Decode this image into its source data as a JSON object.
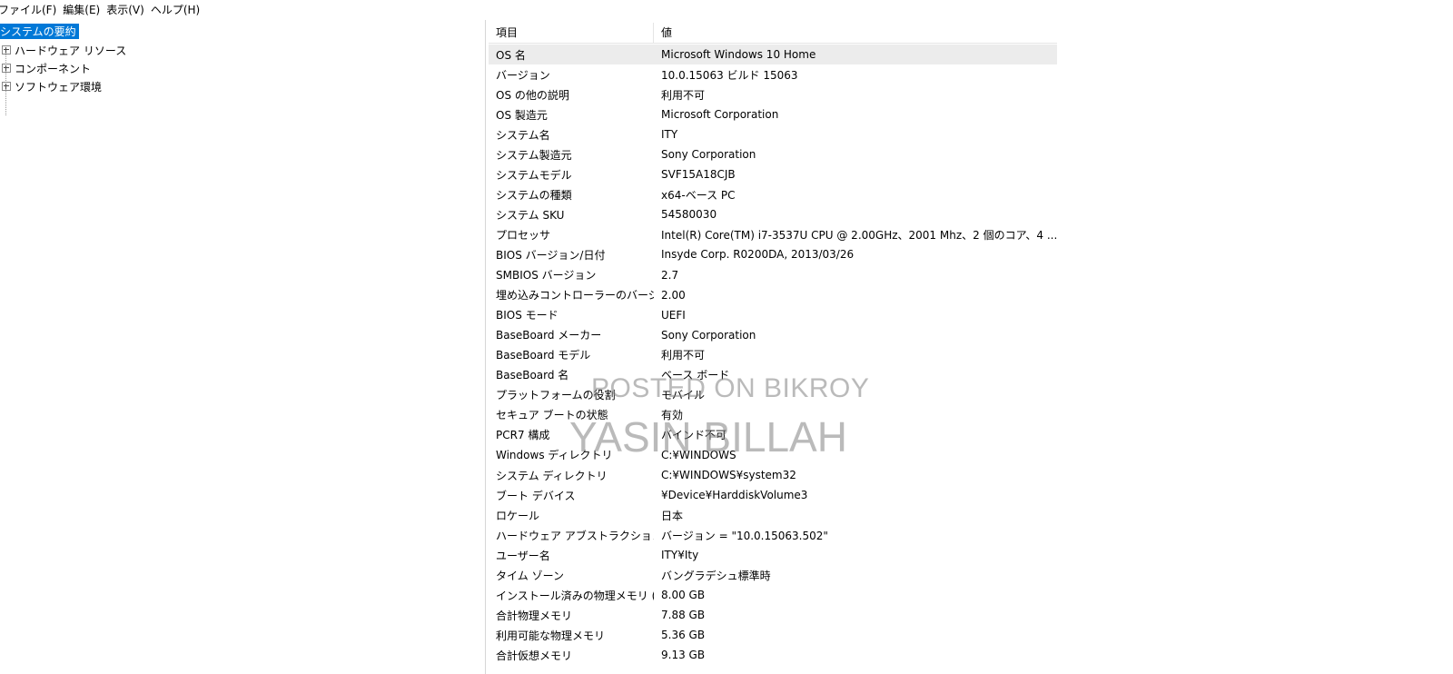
{
  "menubar": {
    "items": [
      "ファイル(F)",
      "編集(E)",
      "表示(V)",
      "ヘルプ(H)"
    ]
  },
  "tree": {
    "root": "システムの要約",
    "children": [
      "ハードウェア リソース",
      "コンポーネント",
      "ソフトウェア環境"
    ]
  },
  "table": {
    "headers": {
      "item": "項目",
      "value": "値"
    },
    "rows": [
      {
        "item": "OS 名",
        "value": "Microsoft Windows 10 Home"
      },
      {
        "item": "バージョン",
        "value": "10.0.15063 ビルド 15063"
      },
      {
        "item": "OS の他の説明",
        "value": "利用不可"
      },
      {
        "item": "OS 製造元",
        "value": "Microsoft Corporation"
      },
      {
        "item": "システム名",
        "value": "ITY"
      },
      {
        "item": "システム製造元",
        "value": "Sony Corporation"
      },
      {
        "item": "システムモデル",
        "value": "SVF15A18CJB"
      },
      {
        "item": "システムの種類",
        "value": "x64-ベース PC"
      },
      {
        "item": "システム SKU",
        "value": "54580030"
      },
      {
        "item": "プロセッサ",
        "value": "Intel(R) Core(TM) i7-3537U CPU @ 2.00GHz、2001 Mhz、2 個のコア、4 ..."
      },
      {
        "item": "BIOS バージョン/日付",
        "value": "Insyde Corp. R0200DA, 2013/03/26"
      },
      {
        "item": "SMBIOS バージョン",
        "value": "2.7"
      },
      {
        "item": "埋め込みコントローラーのバージョ...",
        "value": "2.00"
      },
      {
        "item": "BIOS モード",
        "value": "UEFI"
      },
      {
        "item": "BaseBoard メーカー",
        "value": "Sony Corporation"
      },
      {
        "item": "BaseBoard モデル",
        "value": "利用不可"
      },
      {
        "item": "BaseBoard 名",
        "value": "ベース ボード"
      },
      {
        "item": "プラットフォームの役割",
        "value": "モバイル"
      },
      {
        "item": "セキュア ブートの状態",
        "value": "有効"
      },
      {
        "item": "PCR7 構成",
        "value": "バインド不可"
      },
      {
        "item": "Windows ディレクトリ",
        "value": "C:¥WINDOWS"
      },
      {
        "item": "システム ディレクトリ",
        "value": "C:¥WINDOWS¥system32"
      },
      {
        "item": "ブート デバイス",
        "value": "¥Device¥HarddiskVolume3"
      },
      {
        "item": "ロケール",
        "value": "日本"
      },
      {
        "item": "ハードウェア アブストラクション レ...",
        "value": "バージョン = \"10.0.15063.502\""
      },
      {
        "item": "ユーザー名",
        "value": "ITY¥Ity"
      },
      {
        "item": "タイム ゾーン",
        "value": "バングラデシュ標準時"
      },
      {
        "item": "インストール済みの物理メモリ (...",
        "value": "8.00 GB"
      },
      {
        "item": "合計物理メモリ",
        "value": "7.88 GB"
      },
      {
        "item": "利用可能な物理メモリ",
        "value": "5.36 GB"
      },
      {
        "item": "合計仮想メモリ",
        "value": "9.13 GB"
      }
    ]
  },
  "watermark": {
    "line1": "POSTED ON BIKROY",
    "line2": "YASIN BILLAH"
  }
}
